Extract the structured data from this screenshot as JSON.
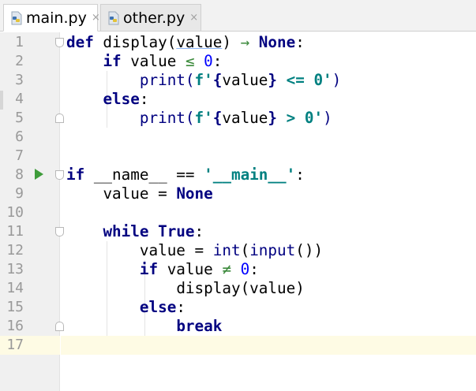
{
  "tabs": [
    {
      "label": "main.py",
      "active": true,
      "icon": "python-file-icon"
    },
    {
      "label": "other.py",
      "active": false,
      "icon": "python-file-icon"
    }
  ],
  "close_glyph": "×",
  "colors": {
    "keyword": "#000080",
    "string": "#008080",
    "number": "#0000ff",
    "current_line": "#fefbe4",
    "run_icon": "#3e9c3a"
  },
  "editor": {
    "current_line": 17,
    "lines": [
      {
        "n": "1"
      },
      {
        "n": "2"
      },
      {
        "n": "3"
      },
      {
        "n": "4"
      },
      {
        "n": "5"
      },
      {
        "n": "6"
      },
      {
        "n": "7"
      },
      {
        "n": "8"
      },
      {
        "n": "9"
      },
      {
        "n": "10"
      },
      {
        "n": "11"
      },
      {
        "n": "12"
      },
      {
        "n": "13"
      },
      {
        "n": "14"
      },
      {
        "n": "15"
      },
      {
        "n": "16"
      },
      {
        "n": "17"
      }
    ],
    "code": {
      "l1": {
        "kw": "def",
        "name": " display(",
        "param": "value",
        "close": ") ",
        "arrow": "→",
        "sp": " ",
        "none": "None",
        "colon": ":"
      },
      "l2": {
        "indent": "    ",
        "kw": "if",
        "rest": " value ",
        "op": "≤",
        "sp": " ",
        "num": "0",
        "colon": ":"
      },
      "l3": {
        "indent": "        ",
        "fn": "print(",
        "prefix": "f'",
        "brace_o": "{",
        "var": "value",
        "brace_c": "}",
        "text": " <= 0'",
        "close": ")"
      },
      "l4": {
        "indent": "    ",
        "kw": "else",
        "colon": ":"
      },
      "l5": {
        "indent": "        ",
        "fn": "print(",
        "prefix": "f'",
        "brace_o": "{",
        "var": "value",
        "brace_c": "}",
        "text": " > 0'",
        "close": ")"
      },
      "l8": {
        "kw": "if",
        "rest": " __name__ == ",
        "str": "'__main__'",
        "colon": ":"
      },
      "l9": {
        "indent": "    ",
        "rest": "value = ",
        "none": "None"
      },
      "l11": {
        "indent": "    ",
        "kw": "while",
        "sp": " ",
        "true": "True",
        "colon": ":"
      },
      "l12": {
        "indent": "        ",
        "rest": "value = ",
        "int": "int",
        "o": "(",
        "input": "input",
        "c": "())"
      },
      "l13": {
        "indent": "        ",
        "kw": "if",
        "rest": " value ",
        "op": "≠",
        "sp": " ",
        "num": "0",
        "colon": ":"
      },
      "l14": {
        "indent": "            ",
        "rest": "display(value)"
      },
      "l15": {
        "indent": "        ",
        "kw": "else",
        "colon": ":"
      },
      "l16": {
        "indent": "            ",
        "kw": "break"
      }
    }
  }
}
